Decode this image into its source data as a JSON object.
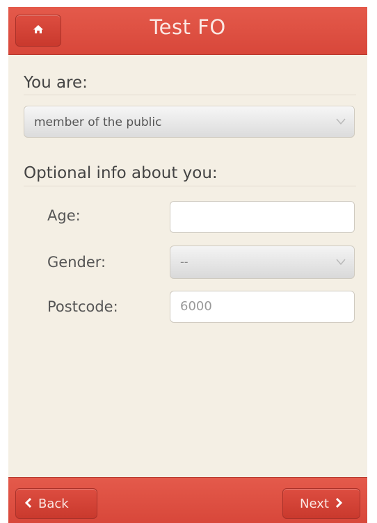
{
  "header": {
    "title": "Test FO",
    "home_icon": "home-icon"
  },
  "form": {
    "you_are_label": "You are:",
    "you_are_selected": "member of the public",
    "optional_label": "Optional info about you:",
    "age_label": "Age:",
    "age_value": "",
    "gender_label": "Gender:",
    "gender_selected": "--",
    "postcode_label": "Postcode:",
    "postcode_placeholder": "6000"
  },
  "footer": {
    "back_label": "Back",
    "next_label": "Next",
    "back_icon": "chevron-left-icon",
    "next_icon": "chevron-right-icon"
  },
  "colors": {
    "header_red": "#e04e40",
    "page_background": "#f4efe4"
  }
}
